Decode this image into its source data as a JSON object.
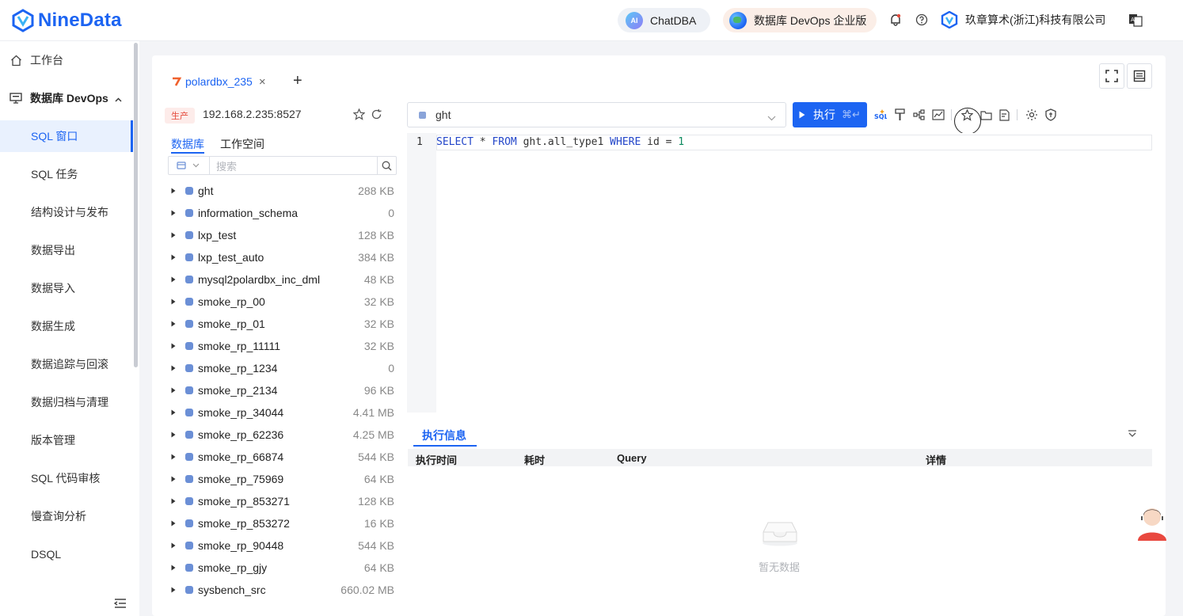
{
  "brand": {
    "name": "NineData"
  },
  "topbar": {
    "chatdba": "ChatDBA",
    "ai_badge": "AI",
    "devops_edition": "数据库 DevOps 企业版",
    "company": "玖章算术(浙江)科技有限公司",
    "icons": [
      "bell-icon",
      "help-icon",
      "translate-icon"
    ]
  },
  "sidenav": {
    "home": "工作台",
    "group": "数据库 DevOps",
    "items": [
      {
        "label": "SQL 窗口",
        "active": true
      },
      {
        "label": "SQL 任务"
      },
      {
        "label": "结构设计与发布"
      },
      {
        "label": "数据导出"
      },
      {
        "label": "数据导入"
      },
      {
        "label": "数据生成"
      },
      {
        "label": "数据追踪与回滚"
      },
      {
        "label": "数据归档与清理"
      },
      {
        "label": "版本管理"
      },
      {
        "label": "SQL 代码审核"
      },
      {
        "label": "慢查询分析"
      },
      {
        "label": "DSQL"
      }
    ]
  },
  "tab": {
    "label": "polardbx_235",
    "close": "×",
    "add": "+"
  },
  "connection": {
    "env": "生产",
    "address": "192.168.2.235:8527"
  },
  "subtabs": {
    "database": "数据库",
    "workspace": "工作空间"
  },
  "search": {
    "placeholder": "搜索"
  },
  "databases": [
    {
      "name": "ght",
      "size": "288 KB"
    },
    {
      "name": "information_schema",
      "size": "0"
    },
    {
      "name": "lxp_test",
      "size": "128 KB"
    },
    {
      "name": "lxp_test_auto",
      "size": "384 KB"
    },
    {
      "name": "mysql2polardbx_inc_dml",
      "size": "48 KB"
    },
    {
      "name": "smoke_rp_00",
      "size": "32 KB"
    },
    {
      "name": "smoke_rp_01",
      "size": "32 KB"
    },
    {
      "name": "smoke_rp_11111",
      "size": "32 KB"
    },
    {
      "name": "smoke_rp_1234",
      "size": "0"
    },
    {
      "name": "smoke_rp_2134",
      "size": "96 KB"
    },
    {
      "name": "smoke_rp_34044",
      "size": "4.41 MB"
    },
    {
      "name": "smoke_rp_62236",
      "size": "4.25 MB"
    },
    {
      "name": "smoke_rp_66874",
      "size": "544 KB"
    },
    {
      "name": "smoke_rp_75969",
      "size": "64 KB"
    },
    {
      "name": "smoke_rp_853271",
      "size": "128 KB"
    },
    {
      "name": "smoke_rp_853272",
      "size": "16 KB"
    },
    {
      "name": "smoke_rp_90448",
      "size": "544 KB"
    },
    {
      "name": "smoke_rp_gjy",
      "size": "64 KB"
    },
    {
      "name": "sysbench_src",
      "size": "660.02 MB"
    }
  ],
  "editor": {
    "selected_db": "ght",
    "run_label": "执行",
    "run_shortcut": "⌘↵",
    "line_number": "1",
    "sql": {
      "kw1": "SELECT",
      "t1": " * ",
      "kw2": "FROM",
      "t2": " ght.all_type1 ",
      "kw3": "WHERE",
      "t3": " id = ",
      "n1": "1"
    },
    "toolbar_icons": [
      "sql-format-icon",
      "paint-brush-icon",
      "tree-icon",
      "chart-icon",
      "star-icon",
      "folder-icon",
      "file-icon",
      "settings-icon",
      "shield-icon"
    ]
  },
  "results": {
    "tab": "执行信息",
    "columns": [
      "执行时间",
      "耗时",
      "Query",
      "详情"
    ],
    "empty": "暂无数据"
  }
}
